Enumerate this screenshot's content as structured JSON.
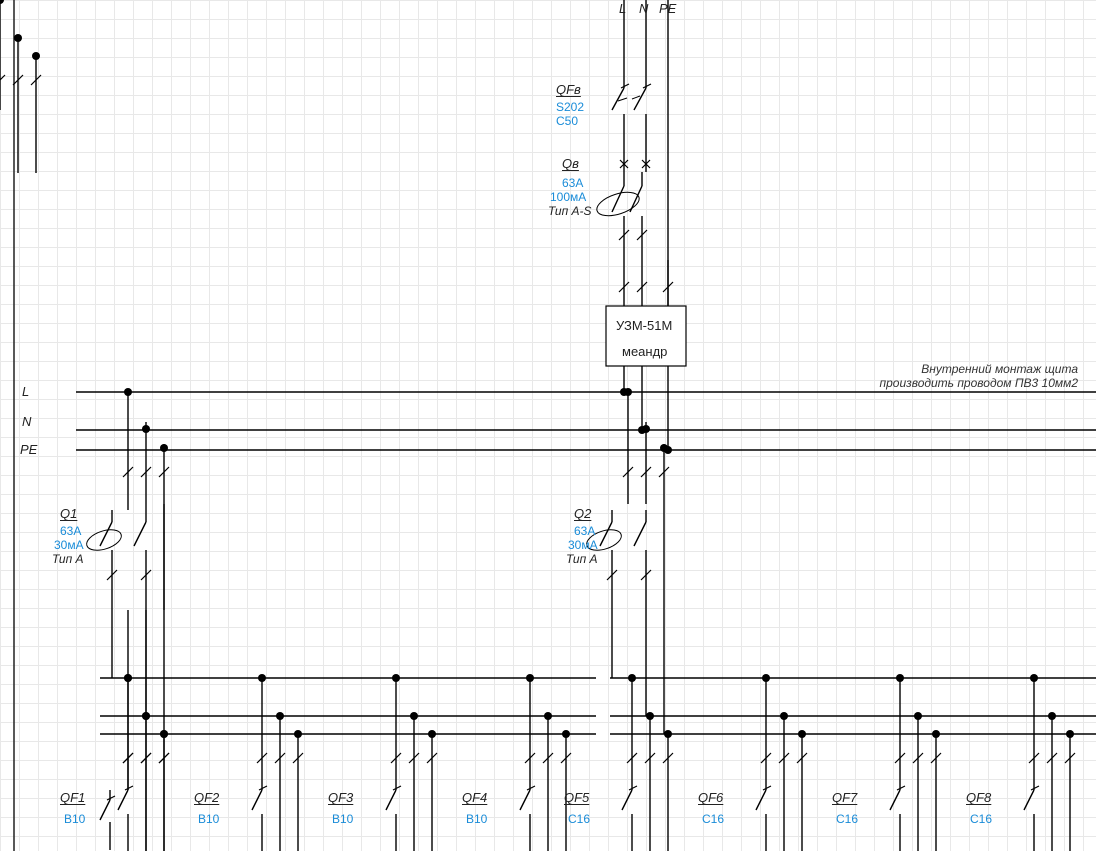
{
  "incoming": {
    "L": "L",
    "N": "N",
    "PE": "PE"
  },
  "qfv": {
    "name": "QFв",
    "model": "S202",
    "rating": "C50"
  },
  "qv": {
    "name": "Qв",
    "rating": "63A",
    "leakage": "100мА",
    "type": "Тип A-S"
  },
  "uzm": {
    "line1": "УЗМ-51М",
    "line2": "меандр"
  },
  "note1": "Внутренний монтаж щита",
  "note2": "производить проводом ПВ3 10мм2",
  "bus": {
    "L": "L",
    "N": "N",
    "PE": "PE"
  },
  "q1": {
    "name": "Q1",
    "rating": "63A",
    "leakage": "30мА",
    "type": "Тип A"
  },
  "q2": {
    "name": "Q2",
    "rating": "63A",
    "leakage": "30мА",
    "type": "Тип A"
  },
  "qf1": {
    "name": "QF1",
    "rating": "B10"
  },
  "qf2": {
    "name": "QF2",
    "rating": "B10"
  },
  "qf3": {
    "name": "QF3",
    "rating": "B10"
  },
  "qf4": {
    "name": "QF4",
    "rating": "B10"
  },
  "qf5": {
    "name": "QF5",
    "rating": "C16"
  },
  "qf6": {
    "name": "QF6",
    "rating": "C16"
  },
  "qf7": {
    "name": "QF7",
    "rating": "C16"
  },
  "qf8": {
    "name": "QF8",
    "rating": "C16"
  }
}
